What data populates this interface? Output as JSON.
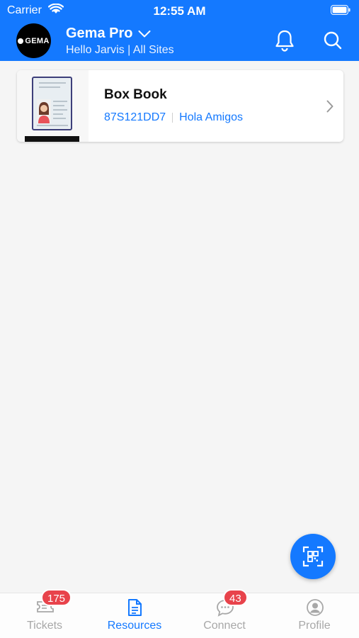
{
  "status_bar": {
    "carrier": "Carrier",
    "time": "12:55 AM"
  },
  "header": {
    "logo_text": "GEMA",
    "app_name": "Gema Pro",
    "subtitle": "Hello Jarvis | All Sites"
  },
  "resources": [
    {
      "title": "Box Book",
      "code": "87S121DD7",
      "site": "Hola Amigos"
    }
  ],
  "tabs": [
    {
      "label": "Tickets",
      "badge": "175",
      "icon": "ticket-icon",
      "active": false
    },
    {
      "label": "Resources",
      "badge": "",
      "icon": "document-icon",
      "active": true
    },
    {
      "label": "Connect",
      "badge": "43",
      "icon": "chat-icon",
      "active": false
    },
    {
      "label": "Profile",
      "badge": "",
      "icon": "profile-icon",
      "active": false
    }
  ],
  "colors": {
    "accent": "#1479ff",
    "badge": "#e8434b",
    "inactive": "#a8a8a8"
  }
}
